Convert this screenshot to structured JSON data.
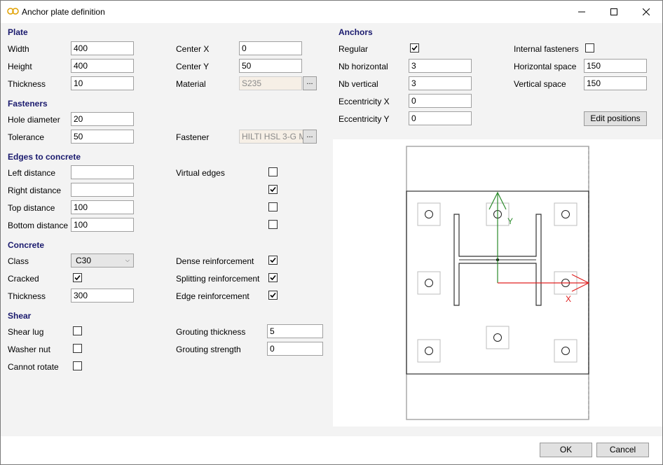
{
  "window": {
    "title": "Anchor plate definition"
  },
  "plate": {
    "heading": "Plate",
    "width_label": "Width",
    "width": "400",
    "height_label": "Height",
    "height": "400",
    "thickness_label": "Thickness",
    "thickness": "10",
    "center_x_label": "Center X",
    "center_x": "0",
    "center_y_label": "Center Y",
    "center_y": "50",
    "material_label": "Material",
    "material": "S235"
  },
  "fasteners": {
    "heading": "Fasteners",
    "hole_diameter_label": "Hole diameter",
    "hole_diameter": "20",
    "tolerance_label": "Tolerance",
    "tolerance": "50",
    "fastener_label": "Fastener",
    "fastener": "HILTI HSL 3-G M"
  },
  "edges": {
    "heading": "Edges to concrete",
    "left_label": "Left distance",
    "left": "",
    "right_label": "Right distance",
    "right": "",
    "top_label": "Top distance",
    "top": "100",
    "bottom_label": "Bottom distance",
    "bottom": "100",
    "virtual_edges_label": "Virtual edges"
  },
  "concrete": {
    "heading": "Concrete",
    "class_label": "Class",
    "class_value": "C30",
    "cracked_label": "Cracked",
    "thickness_label": "Thickness",
    "thickness": "300",
    "dense_label": "Dense reinforcement",
    "splitting_label": "Splitting reinforcement",
    "edge_label": "Edge reinforcement"
  },
  "shear": {
    "heading": "Shear",
    "shear_lug_label": "Shear lug",
    "washer_nut_label": "Washer nut",
    "cannot_rotate_label": "Cannot rotate",
    "grouting_thickness_label": "Grouting thickness",
    "grouting_thickness": "5",
    "grouting_strength_label": "Grouting strength",
    "grouting_strength": "0"
  },
  "anchors": {
    "heading": "Anchors",
    "regular_label": "Regular",
    "nb_horizontal_label": "Nb horizontal",
    "nb_horizontal": "3",
    "nb_vertical_label": "Nb vertical",
    "nb_vertical": "3",
    "ecc_x_label": "Eccentricity X",
    "ecc_x": "0",
    "ecc_y_label": "Eccentricity Y",
    "ecc_y": "0",
    "internal_label": "Internal fasteners",
    "h_space_label": "Horizontal space",
    "h_space": "150",
    "v_space_label": "Vertical space",
    "v_space": "150",
    "edit_positions": "Edit positions"
  },
  "drawing": {
    "axis_x": "X",
    "axis_y": "Y"
  },
  "footer": {
    "ok": "OK",
    "cancel": "Cancel"
  },
  "colors": {
    "heading": "#1a1a6e",
    "axis_x": "#e02020",
    "axis_y": "#2a8a2a"
  }
}
